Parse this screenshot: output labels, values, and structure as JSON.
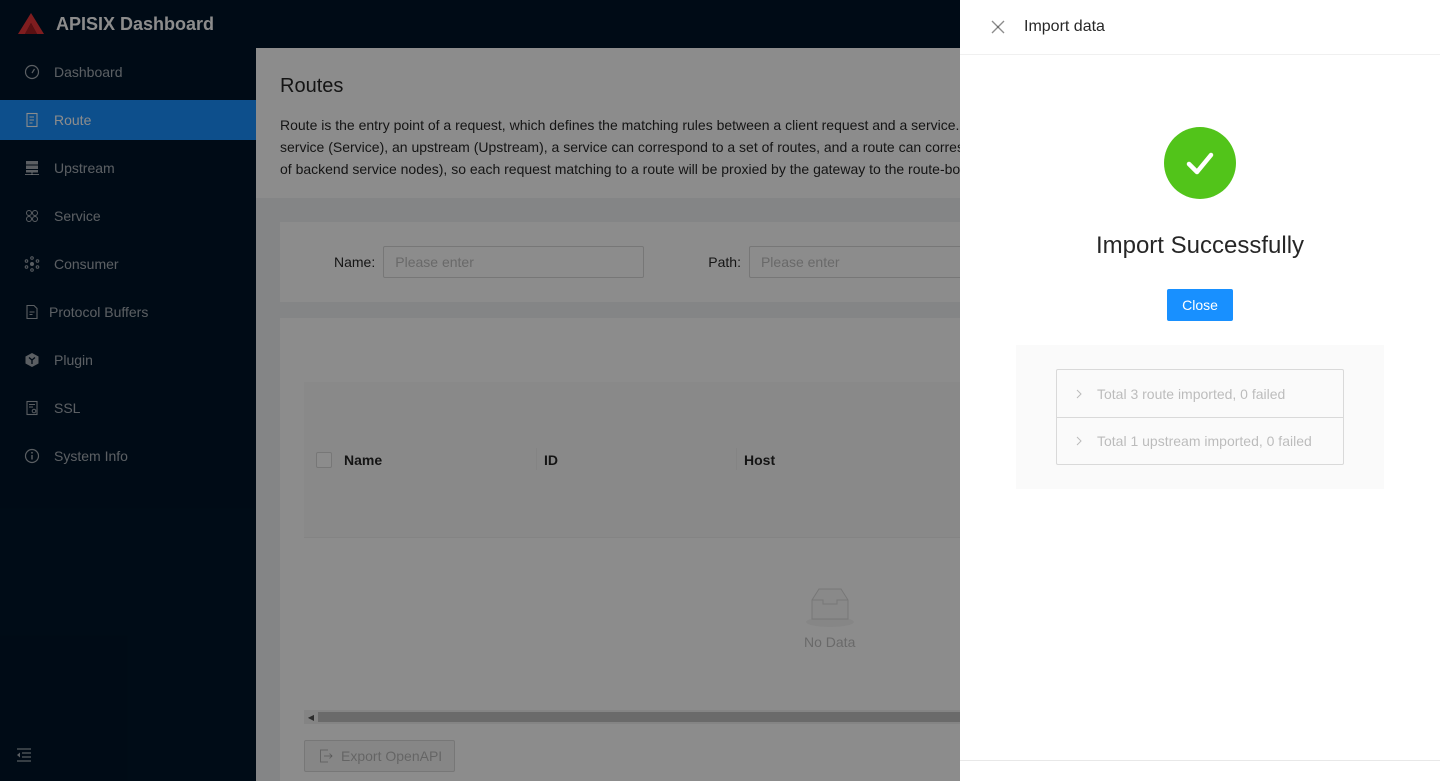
{
  "app": {
    "title": "APISIX Dashboard"
  },
  "sidebar": {
    "items": [
      {
        "label": "Dashboard",
        "icon": "dashboard-icon",
        "active": false
      },
      {
        "label": "Route",
        "icon": "route-icon",
        "active": true
      },
      {
        "label": "Upstream",
        "icon": "upstream-icon",
        "active": false
      },
      {
        "label": "Service",
        "icon": "service-icon",
        "active": false
      },
      {
        "label": "Consumer",
        "icon": "consumer-icon",
        "active": false
      },
      {
        "label": "Protocol Buffers",
        "icon": "file-icon",
        "active": false
      },
      {
        "label": "Plugin",
        "icon": "plugin-icon",
        "active": false
      },
      {
        "label": "SSL",
        "icon": "ssl-icon",
        "active": false
      },
      {
        "label": "System Info",
        "icon": "info-icon",
        "active": false
      }
    ],
    "collapse_icon": "menu-fold-icon"
  },
  "page": {
    "title": "Routes",
    "description": "Route is the entry point of a request, which defines the matching rules between a client request and a service. A route can be associated with a service (Service), an upstream (Upstream), a service can correspond to a set of routes, and a route can correspond to an upstream object (a set of backend service nodes), so each request matching to a route will be proxied by the gateway to the route-bound upstream service."
  },
  "search": {
    "fields": [
      {
        "label": "Name",
        "placeholder": "Please enter",
        "value": ""
      },
      {
        "label": "Path",
        "placeholder": "Please enter",
        "value": ""
      }
    ]
  },
  "table": {
    "columns": [
      "Name",
      "ID",
      "Host"
    ],
    "rows": [],
    "empty_text": "No Data"
  },
  "footer_actions": {
    "export_label": "Export OpenAPI"
  },
  "drawer": {
    "title": "Import data",
    "result": {
      "status": "success",
      "title": "Import Successfully",
      "close_label": "Close",
      "color": "#52c41a"
    },
    "details": [
      {
        "text": "Total 3 route imported, 0 failed"
      },
      {
        "text": "Total 1 upstream imported, 0 failed"
      }
    ]
  },
  "colors": {
    "primary": "#1890ff",
    "sidebar_bg": "#001529",
    "success": "#52c41a",
    "logo_red": "#e8353a"
  }
}
